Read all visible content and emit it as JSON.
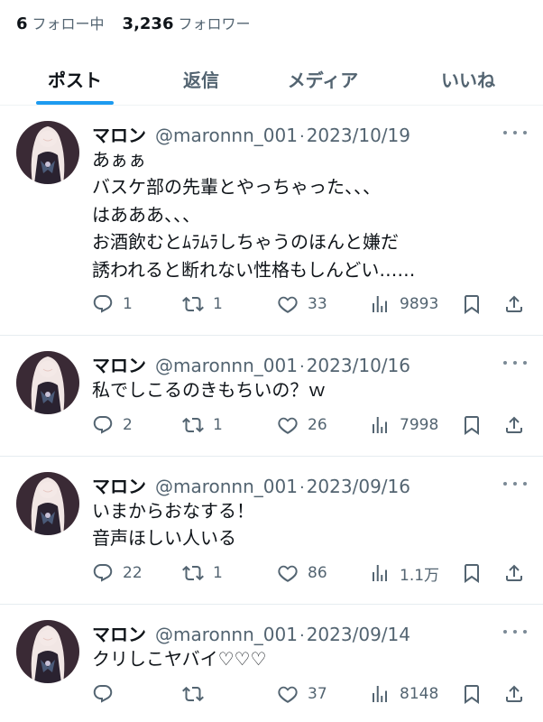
{
  "profile": {
    "following_count": "6",
    "following_label": "フォロー中",
    "followers_count": "3,236",
    "followers_label": "フォロワー"
  },
  "tabs": [
    {
      "label": "ポスト",
      "active": true
    },
    {
      "label": "返信",
      "active": false
    },
    {
      "label": "メディア",
      "active": false
    },
    {
      "label": "いいね",
      "active": false
    }
  ],
  "posts": [
    {
      "name": "マロン",
      "handle": "@maronnn_001",
      "separator": "·",
      "date": "2023/10/19",
      "lines": [
        "あぁぁ",
        "バスケ部の先輩とやっちゃった、、、",
        "はあああ、、、",
        "お酒飲むとﾑﾗﾑﾗしちゃうのほんと嫌だ",
        "誘われると断れない性格もしんどい……"
      ],
      "replies": "1",
      "reposts": "1",
      "likes": "33",
      "views": "9893"
    },
    {
      "name": "マロン",
      "handle": "@maronnn_001",
      "separator": "·",
      "date": "2023/10/16",
      "lines": [
        "私でしこるのきもちいの？ｗ"
      ],
      "replies": "2",
      "reposts": "1",
      "likes": "26",
      "views": "7998"
    },
    {
      "name": "マロン",
      "handle": "@maronnn_001",
      "separator": "·",
      "date": "2023/09/16",
      "lines": [
        "いまからおなする！",
        "音声ほしい人いる"
      ],
      "replies": "22",
      "reposts": "1",
      "likes": "86",
      "views": "1.1万"
    },
    {
      "name": "マロン",
      "handle": "@maronnn_001",
      "separator": "·",
      "date": "2023/09/14",
      "lines": [
        "クリしこヤバイ♡♡♡"
      ],
      "replies": "",
      "reposts": "",
      "likes": "37",
      "views": "8148"
    }
  ],
  "icons": {
    "reply": "reply-icon",
    "repost": "repost-icon",
    "like": "like-icon",
    "views": "views-icon",
    "bookmark": "bookmark-icon",
    "share": "share-icon",
    "more": "more-icon"
  },
  "colors": {
    "accent": "#1d9bf0",
    "text": "#0f1419",
    "muted": "#536471",
    "divider": "#eff3f4"
  }
}
